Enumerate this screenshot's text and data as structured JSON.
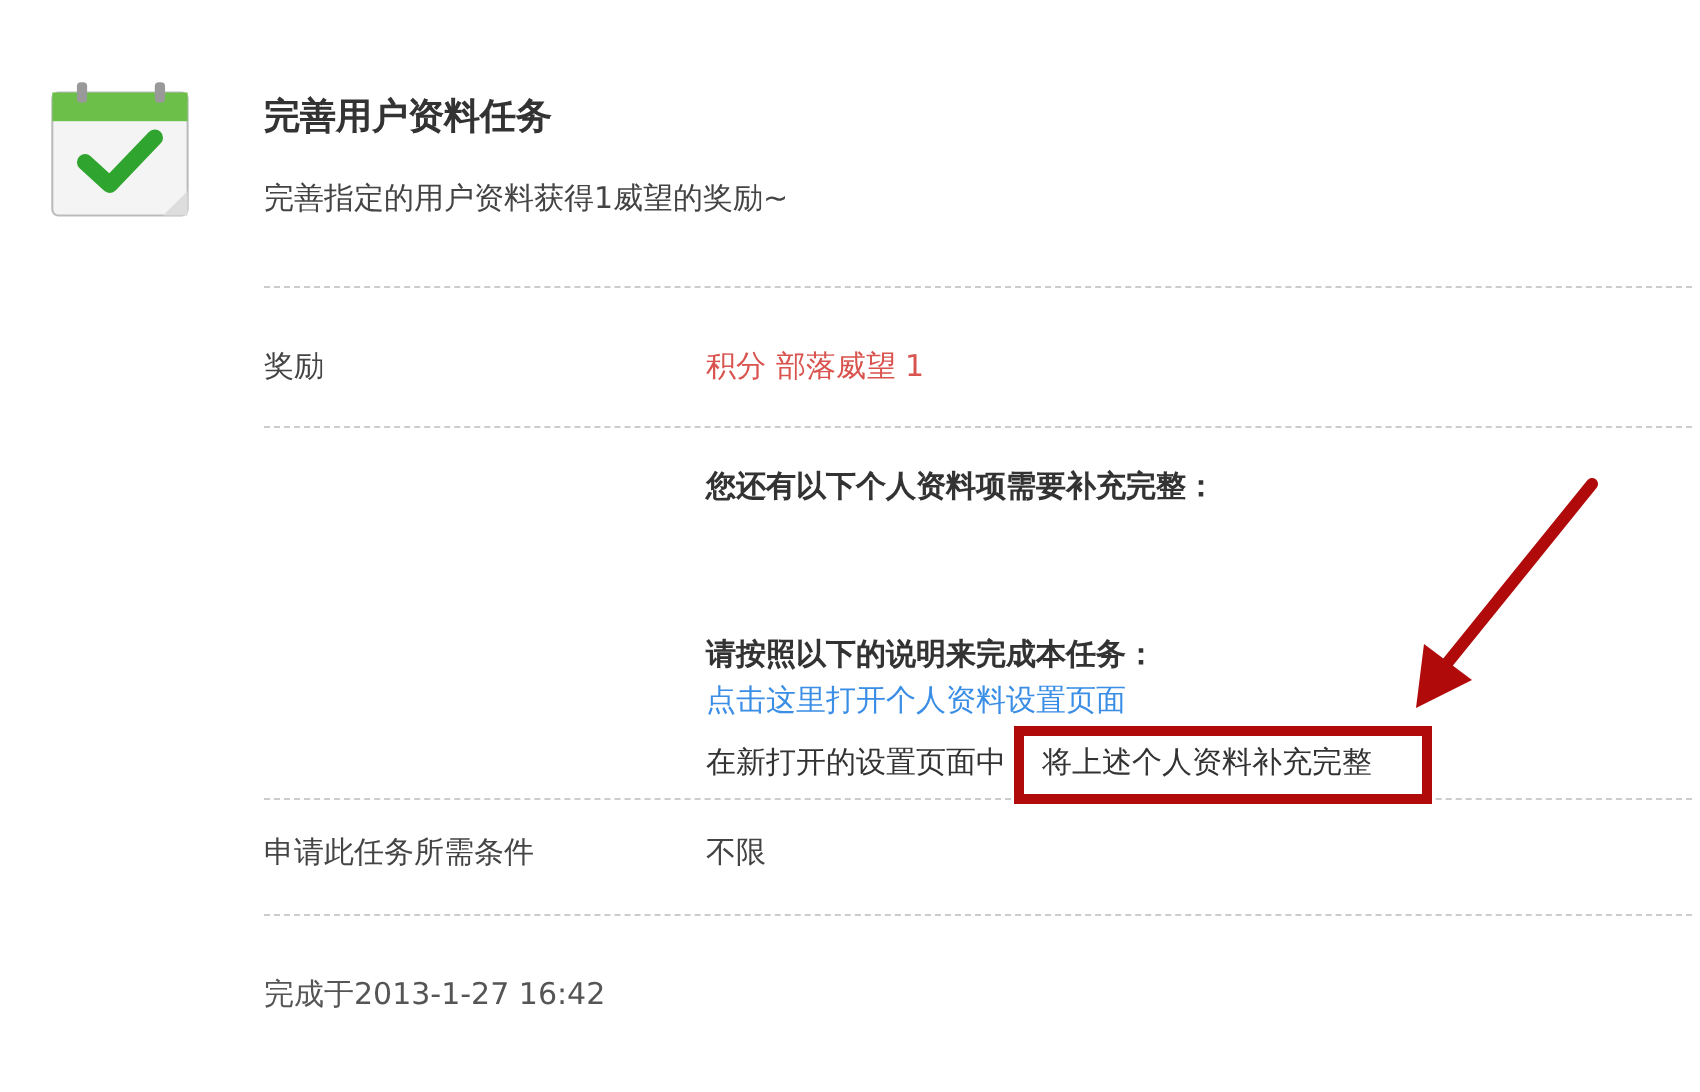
{
  "task": {
    "title": "完善用户资料任务",
    "description": "完善指定的用户资料获得1威望的奖励~"
  },
  "rows": [
    {
      "kind": "reward",
      "label": "奖励",
      "value": "积分 部落威望 1"
    },
    {
      "kind": "instructions",
      "missing_heading": "您还有以下个人资料项需要补充完整：",
      "steps_heading": "请按照以下的说明来完成本任务：",
      "link": "点击这里打开个人资料设置页面",
      "step_text": "在新打开的设置页面中",
      "highlighted_text": "将上述个人资料补充完整"
    },
    {
      "kind": "plain",
      "label": "申请此任务所需条件",
      "value": "不限"
    }
  ],
  "completed": "完成于2013-1-27 16:42"
}
